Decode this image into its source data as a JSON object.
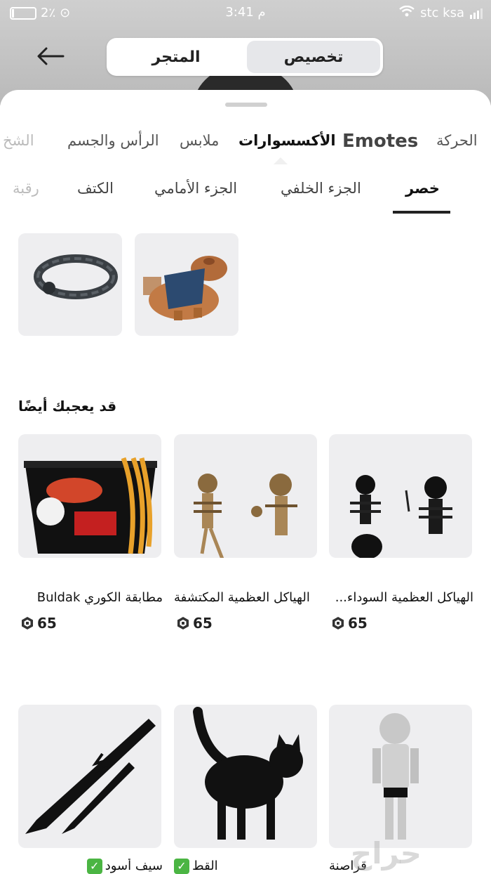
{
  "status_bar": {
    "battery": "2٪",
    "time": "3:41 م",
    "carrier": "stc ksa"
  },
  "header": {
    "tab_store": "المتجر",
    "tab_customize": "تخصيص"
  },
  "categories": [
    "الحركة",
    "Emotes",
    "الأكسسوارات",
    "ملابس",
    "الرأس والجسم",
    "الشخ"
  ],
  "subcategories": [
    "خصر",
    "الجزء الخلفي",
    "الجزء الأمامي",
    "الكتف",
    "رقبة"
  ],
  "section_title": "قد يعجبك أيضًا",
  "recommended": [
    {
      "name": "الهياكل العظمية السوداء...",
      "price": "65"
    },
    {
      "name": "الهياكل العظمية المكتشفة",
      "price": "65"
    },
    {
      "name": "مطابقة الكوري  Buldak",
      "price": "65"
    }
  ],
  "owned": [
    {
      "name": "قراصنة"
    },
    {
      "name": "القط",
      "check": "✓"
    },
    {
      "name": "سيف أسود",
      "check": "✓"
    }
  ],
  "watermark": "حراج",
  "colors": {
    "accent": "#222222",
    "card_bg": "#eeeef0",
    "check_green": "#4bb543"
  }
}
